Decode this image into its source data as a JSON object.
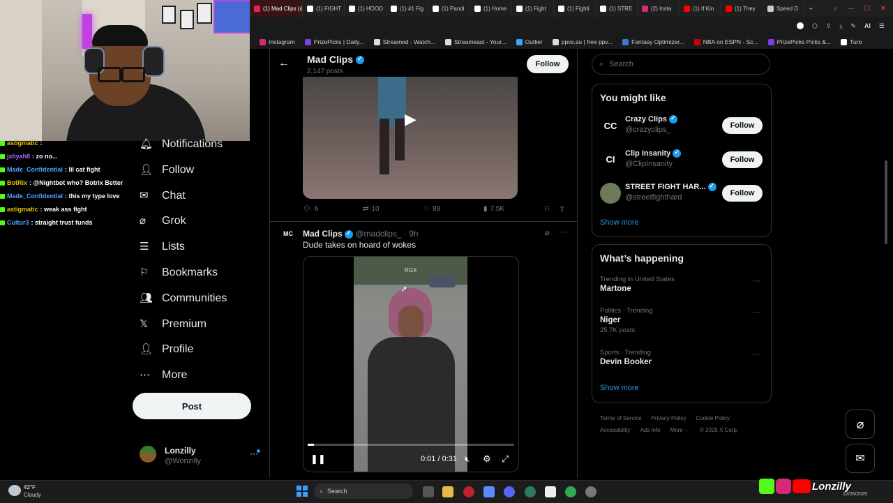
{
  "browser": {
    "tabs": [
      {
        "label": "(1) Mad Clips (@",
        "active": true,
        "color": "#e0245e"
      },
      {
        "label": "(1) FIGHT",
        "active": false,
        "color": "#ffffff"
      },
      {
        "label": "(1) HOOD",
        "active": false,
        "color": "#ffffff"
      },
      {
        "label": "(1) #1 Fig",
        "active": false,
        "color": "#ffffff"
      },
      {
        "label": "(1) Pandi",
        "active": false,
        "color": "#ffffff"
      },
      {
        "label": "(1) Home",
        "active": false,
        "color": "#ffffff"
      },
      {
        "label": "(1) Fight",
        "active": false,
        "color": "#ffffff"
      },
      {
        "label": "(1) Fighti",
        "active": false,
        "color": "#ffffff"
      },
      {
        "label": "(1) STRE",
        "active": false,
        "color": "#ffffff"
      },
      {
        "label": "(2) Insta",
        "active": false,
        "color": "#d62976"
      },
      {
        "label": "(1) If Kin",
        "active": false,
        "color": "#ff0000"
      },
      {
        "label": "(1) They",
        "active": false,
        "color": "#ff0000"
      },
      {
        "label": "Speed D",
        "active": false,
        "color": "#cccccc"
      }
    ],
    "new_tab": "+",
    "toolbar_label": "AI",
    "bookmarks": [
      {
        "label": "Instagram",
        "color": "#d62976"
      },
      {
        "label": "PrizePicks | Daily...",
        "color": "#7b3fe4"
      },
      {
        "label": "Streamed - Watch...",
        "color": "#dddddd"
      },
      {
        "label": "Streameast - Your...",
        "color": "#dddddd"
      },
      {
        "label": "Outlier",
        "color": "#3aa3ff"
      },
      {
        "label": "ppvs.su | free ppv...",
        "color": "#dddddd"
      },
      {
        "label": "Fantasy Optimizer...",
        "color": "#3a7bd5"
      },
      {
        "label": "NBA on ESPN - Sc...",
        "color": "#d00000"
      },
      {
        "label": "PrizePicks Picks &...",
        "color": "#7b3fe4"
      },
      {
        "label": "Turo",
        "color": "#ffffff"
      }
    ]
  },
  "chat": [
    {
      "user": "astigmatic",
      "msg": ":",
      "color": "#e6c100"
    },
    {
      "user": "jxliyah8",
      "msg": ": zo no...",
      "color": "#b366ff"
    },
    {
      "user": "Made_Confidential",
      "msg": ": lil cat fight",
      "color": "#4aa3ff"
    },
    {
      "user": "BotRix",
      "msg": ": @Nightbot who? Botrix Better",
      "color": "#e6c100"
    },
    {
      "user": "Made_Confidential",
      "msg": ": this my type love",
      "color": "#4aa3ff"
    },
    {
      "user": "astigmatic",
      "msg": ": weak ass fight",
      "color": "#e6c100"
    },
    {
      "user": "Cultur3",
      "msg": ": straight trust funds",
      "color": "#4aa3ff"
    }
  ],
  "nav": {
    "items": [
      {
        "label": "Notifications",
        "icon": "bell-icon"
      },
      {
        "label": "Follow",
        "icon": "follow-icon"
      },
      {
        "label": "Chat",
        "icon": "chat-icon"
      },
      {
        "label": "Grok",
        "icon": "grok-icon"
      },
      {
        "label": "Lists",
        "icon": "list-icon"
      },
      {
        "label": "Bookmarks",
        "icon": "bookmark-icon"
      },
      {
        "label": "Communities",
        "icon": "communities-icon"
      },
      {
        "label": "Premium",
        "icon": "x-logo-icon"
      },
      {
        "label": "Profile",
        "icon": "profile-icon"
      },
      {
        "label": "More",
        "icon": "more-icon"
      }
    ],
    "post_button": "Post",
    "account": {
      "name": "Lonzilly",
      "handle": "@Wonzilly",
      "menu": "···"
    }
  },
  "profile_header": {
    "name": "Mad Clips",
    "posts": "2,147 posts",
    "follow": "Follow"
  },
  "post1": {
    "replies": "6",
    "reposts": "10",
    "likes": "89",
    "views": "7.5K"
  },
  "post2": {
    "name": "Mad Clips",
    "handle": "@madclips_",
    "time": "· 9h",
    "text": "Dude takes on hoard of wokes",
    "video_overlay": "RGX",
    "video_time": "0:01 / 0:31",
    "progress": 0.03
  },
  "search": {
    "placeholder": "Search"
  },
  "you_might_like": {
    "title": "You might like",
    "items": [
      {
        "name": "Crazy Clips",
        "handle": "@crazyclips_",
        "follow": "Follow",
        "avatar": "CC"
      },
      {
        "name": "Clip Insanity",
        "handle": "@ClipInsanity",
        "follow": "Follow",
        "avatar": "CI"
      },
      {
        "name": "STREET FIGHT HAR...",
        "handle": "@streetfighthard",
        "follow": "Follow",
        "avatar": ""
      }
    ],
    "show_more": "Show more"
  },
  "whats_happening": {
    "title": "What’s happening",
    "trends": [
      {
        "category": "Trending in United States",
        "name": "Martone",
        "count": ""
      },
      {
        "category": "Politics · Trending",
        "name": "Niger",
        "count": "25.7K posts"
      },
      {
        "category": "Sports · Trending",
        "name": "Devin Booker",
        "count": ""
      }
    ],
    "show_more": "Show more"
  },
  "footer": {
    "row1": [
      "Terms of Service",
      "Privacy Policy",
      "Cookie Policy"
    ],
    "row2": [
      "Accessibility",
      "Ads info",
      "More ···",
      "© 2025 X Corp."
    ]
  },
  "taskbar": {
    "weather_temp": "42°F",
    "weather_desc": "Cloudy",
    "search": "Search",
    "date": "12/26/2025",
    "stream_name": "Lonzilly"
  }
}
